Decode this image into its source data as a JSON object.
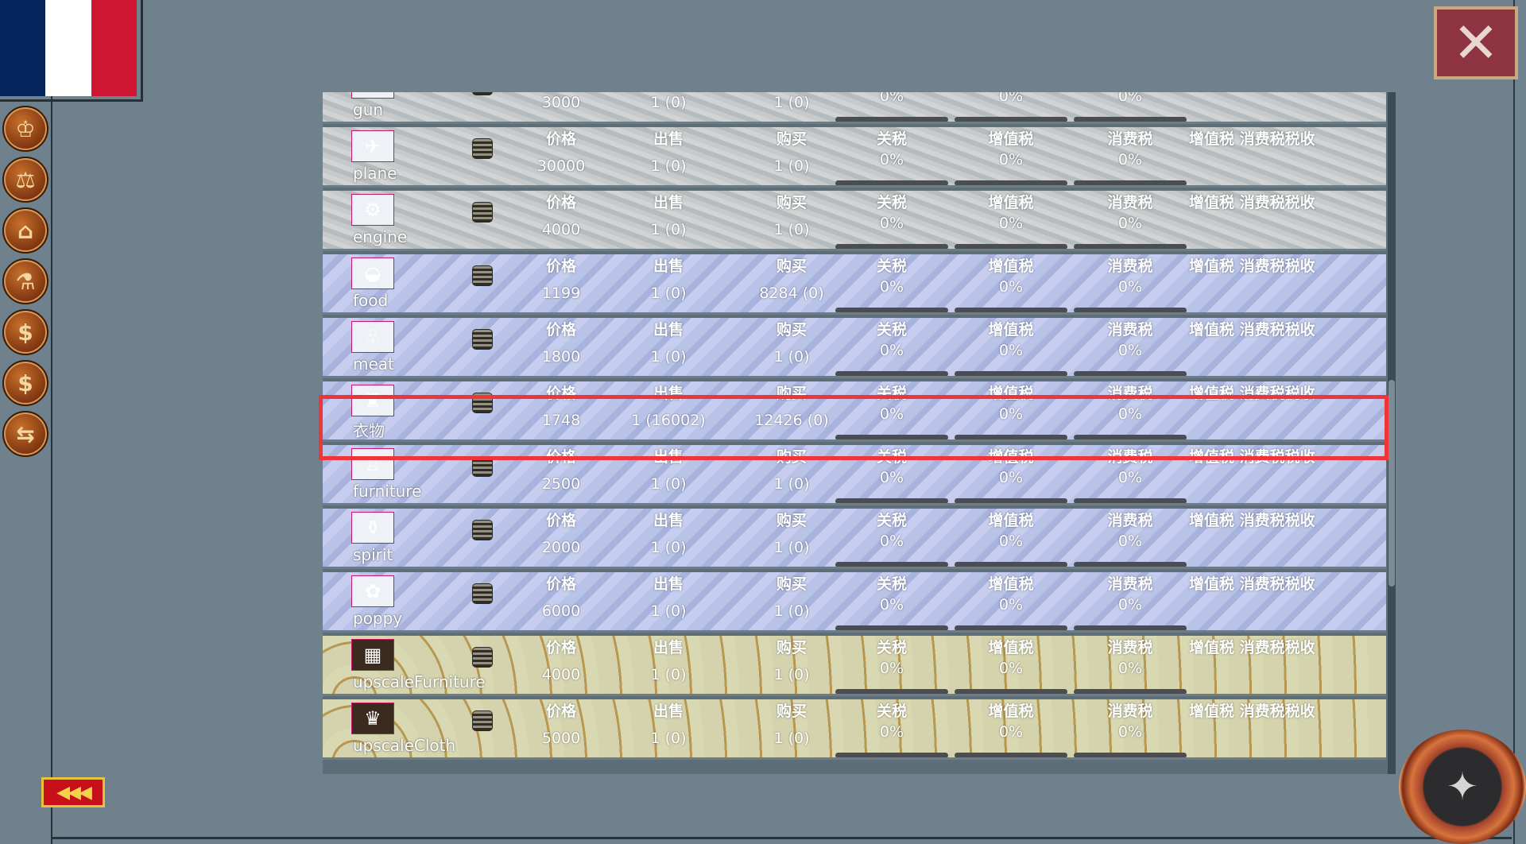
{
  "headers": {
    "price": "价格",
    "sell": "出售",
    "buy": "购买",
    "tariff": "关税",
    "vat": "增值税",
    "consumption_tax": "消费税",
    "tax_income": "增值税 消费税税收"
  },
  "goods": [
    {
      "name": "gun",
      "price": "3000",
      "sell": "1 (0)",
      "buy": "1 (0)",
      "tariff": "0%",
      "vat": "0%",
      "consumption_tax": "0%",
      "style": "gray",
      "icon": "pistol-icon"
    },
    {
      "name": "plane",
      "price": "30000",
      "sell": "1 (0)",
      "buy": "1 (0)",
      "tariff": "0%",
      "vat": "0%",
      "consumption_tax": "0%",
      "style": "gray",
      "icon": "plane-icon"
    },
    {
      "name": "engine",
      "price": "4000",
      "sell": "1 (0)",
      "buy": "1 (0)",
      "tariff": "0%",
      "vat": "0%",
      "consumption_tax": "0%",
      "style": "gray",
      "icon": "engine-icon"
    },
    {
      "name": "food",
      "price": "1199",
      "sell": "1 (0)",
      "buy": "8284 (0)",
      "tariff": "0%",
      "vat": "0%",
      "consumption_tax": "0%",
      "style": "blue",
      "icon": "bread-icon"
    },
    {
      "name": "meat",
      "price": "1800",
      "sell": "1 (0)",
      "buy": "1 (0)",
      "tariff": "0%",
      "vat": "0%",
      "consumption_tax": "0%",
      "style": "blue",
      "icon": "pig-icon"
    },
    {
      "name": "衣物",
      "price": "1748",
      "sell": "1 (16002)",
      "buy": "12426 (0)",
      "tariff": "0%",
      "vat": "0%",
      "consumption_tax": "0%",
      "style": "blue",
      "icon": "clothes-icon",
      "selected": true
    },
    {
      "name": "furniture",
      "price": "2500",
      "sell": "1 (0)",
      "buy": "1 (0)",
      "tariff": "0%",
      "vat": "0%",
      "consumption_tax": "0%",
      "style": "blue",
      "icon": "chair-icon"
    },
    {
      "name": "spirit",
      "price": "2000",
      "sell": "1 (0)",
      "buy": "1 (0)",
      "tariff": "0%",
      "vat": "0%",
      "consumption_tax": "0%",
      "style": "blue",
      "icon": "bottle-icon"
    },
    {
      "name": "poppy",
      "price": "6000",
      "sell": "1 (0)",
      "buy": "1 (0)",
      "tariff": "0%",
      "vat": "0%",
      "consumption_tax": "0%",
      "style": "blue",
      "icon": "flower-icon"
    },
    {
      "name": "upscaleFurniture",
      "price": "4000",
      "sell": "1 (0)",
      "buy": "1 (0)",
      "tariff": "0%",
      "vat": "0%",
      "consumption_tax": "0%",
      "style": "tan",
      "icon": "cabinet-icon"
    },
    {
      "name": "upscaleCloth",
      "price": "5000",
      "sell": "1 (0)",
      "buy": "1 (0)",
      "tariff": "0%",
      "vat": "0%",
      "consumption_tax": "0%",
      "style": "tan",
      "icon": "dress-icon"
    }
  ],
  "colors": {
    "background": "#6e818c",
    "selection": "#f0343a",
    "flag_blue": "#05245b",
    "flag_red": "#cf1733"
  },
  "side_buttons": [
    "crown-icon",
    "scales-icon",
    "government-building-icon",
    "research-icon",
    "dollar-icon",
    "dollar-icon",
    "trade-icon"
  ]
}
